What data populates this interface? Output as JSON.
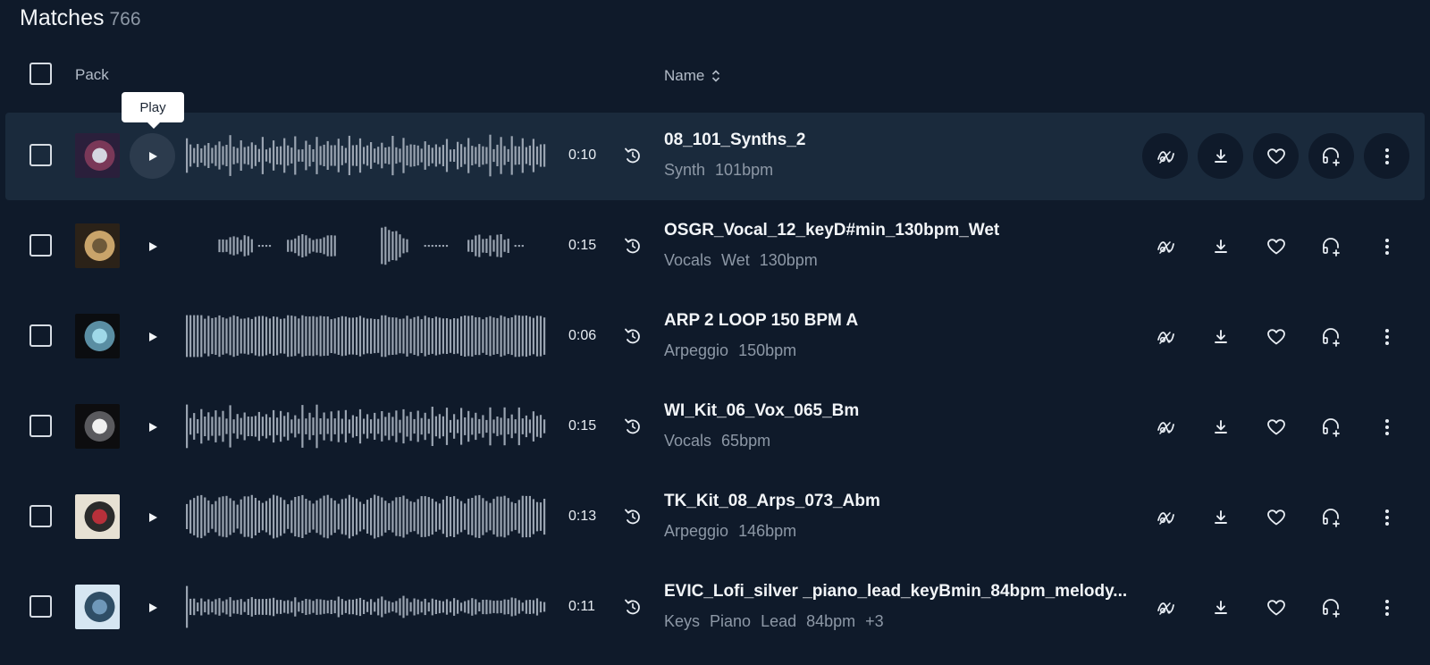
{
  "header": {
    "title": "Matches",
    "count": "766"
  },
  "columns": {
    "pack": "Pack",
    "name": "Name"
  },
  "tooltip": "Play",
  "rows": [
    {
      "name": "08_101_Synths_2",
      "duration": "0:10",
      "tags": [
        "Synth",
        "101bpm"
      ],
      "thumb_colors": [
        "#2a1f3b",
        "#d4d6e0",
        "#7a3858"
      ]
    },
    {
      "name": "OSGR_Vocal_12_keyD#min_130bpm_Wet",
      "duration": "0:15",
      "tags": [
        "Vocals",
        "Wet",
        "130bpm"
      ],
      "thumb_colors": [
        "#2b2218",
        "#6e5a3a",
        "#c9a46a"
      ]
    },
    {
      "name": "ARP 2 LOOP 150 BPM A",
      "duration": "0:06",
      "tags": [
        "Arpeggio",
        "150bpm"
      ],
      "thumb_colors": [
        "#0b0d10",
        "#9fd8e8",
        "#5a8ea3"
      ]
    },
    {
      "name": "WI_Kit_06_Vox_065_Bm",
      "duration": "0:15",
      "tags": [
        "Vocals",
        "65bpm"
      ],
      "thumb_colors": [
        "#0d0d0f",
        "#f0f0f0",
        "#5a5a5e"
      ]
    },
    {
      "name": "TK_Kit_08_Arps_073_Abm",
      "duration": "0:13",
      "tags": [
        "Arpeggio",
        "146bpm"
      ],
      "thumb_colors": [
        "#e7e1d3",
        "#b7303a",
        "#2b2b2b"
      ]
    },
    {
      "name": "EVIC_Lofi_silver _piano_lead_keyBmin_84bpm_melody...",
      "duration": "0:11",
      "tags": [
        "Keys",
        "Piano",
        "Lead",
        "84bpm",
        "+3"
      ],
      "thumb_colors": [
        "#d6e6f2",
        "#6f98b9",
        "#2f4e66"
      ]
    }
  ],
  "actions": [
    "sample-match-icon",
    "download-icon",
    "heart-icon",
    "headphones-add-icon",
    "more-vertical-icon"
  ],
  "colors": {
    "background": "#0f1a2a",
    "active_row": "#1a2a3c",
    "waveform": "#9aa4b1",
    "muted_text": "#8d98a6"
  }
}
